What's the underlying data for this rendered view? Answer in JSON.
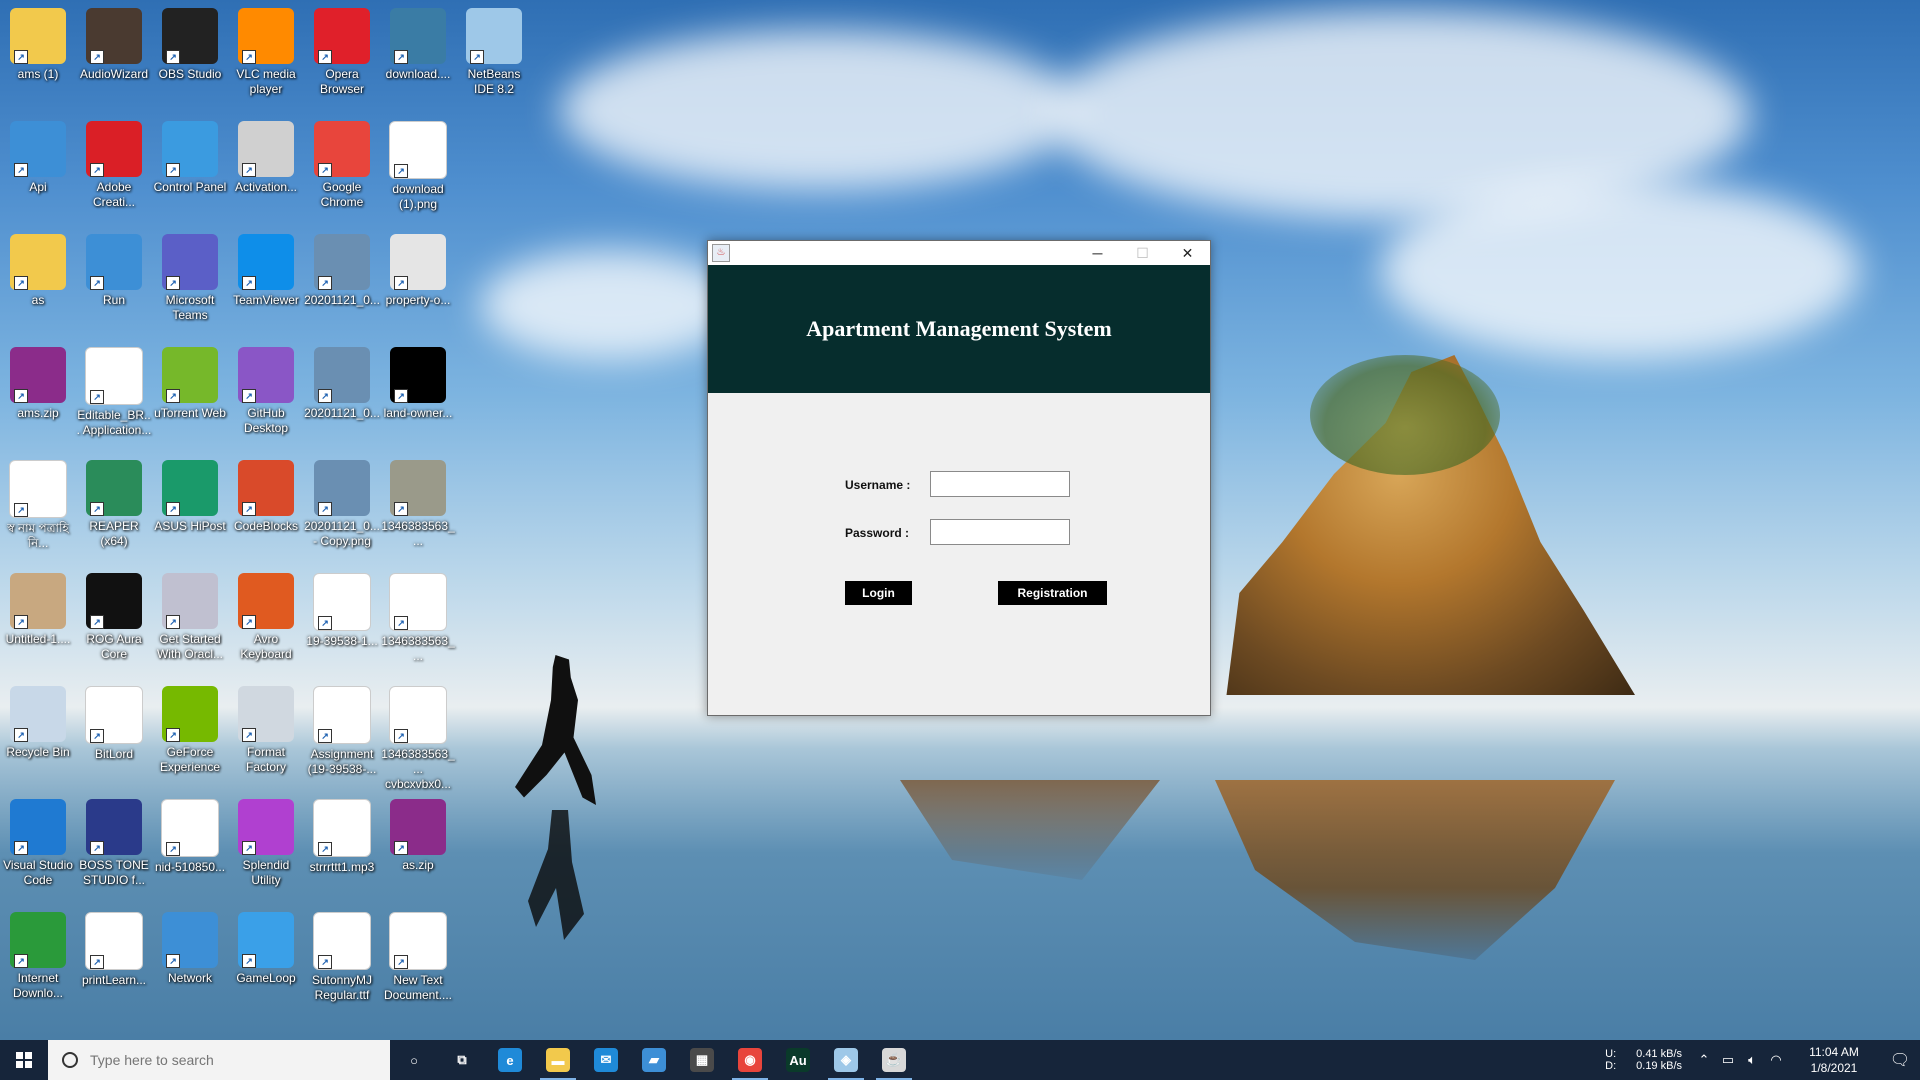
{
  "desktop": {
    "icons": [
      {
        "label": "ams (1)",
        "icon": "folder-icon",
        "color": "#f2c94c"
      },
      {
        "label": "AudioWizard",
        "icon": "audiowizard-icon",
        "color": "#4a3a30"
      },
      {
        "label": "OBS Studio",
        "icon": "obs-icon",
        "color": "#222"
      },
      {
        "label": "VLC media player",
        "icon": "vlc-icon",
        "color": "#ff8a00"
      },
      {
        "label": "Opera Browser",
        "icon": "opera-icon",
        "color": "#e0202a"
      },
      {
        "label": "download....",
        "icon": "user-image-icon",
        "color": "#3a7ca5"
      },
      {
        "label": "NetBeans IDE 8.2",
        "icon": "netbeans-icon",
        "color": "#9ec8e8"
      },
      {
        "label": "Api",
        "icon": "computer-icon",
        "color": "#3d8fd6"
      },
      {
        "label": "Adobe Creati...",
        "icon": "adobe-cc-icon",
        "color": "#da1f26"
      },
      {
        "label": "Control Panel",
        "icon": "control-panel-icon",
        "color": "#3b9be0"
      },
      {
        "label": "Activation...",
        "icon": "gears-icon",
        "color": "#d0d0d0"
      },
      {
        "label": "Google Chrome",
        "icon": "chrome-icon",
        "color": "#e8453c"
      },
      {
        "label": "download (1).png",
        "icon": "house-image-icon",
        "color": "#ffffff"
      },
      {
        "label": "as",
        "icon": "folder-icon",
        "color": "#f2c94c"
      },
      {
        "label": "Run",
        "icon": "run-icon",
        "color": "#3d8fd6"
      },
      {
        "label": "Microsoft Teams",
        "icon": "teams-icon",
        "color": "#5b5fc7"
      },
      {
        "label": "TeamViewer",
        "icon": "teamviewer-icon",
        "color": "#0e8ee9"
      },
      {
        "label": "20201121_0...",
        "icon": "photo-icon",
        "color": "#6a8fb2"
      },
      {
        "label": "property-o...",
        "icon": "image-icon",
        "color": "#e5e5e5"
      },
      {
        "label": "ams.zip",
        "icon": "winrar-icon",
        "color": "#8b2c8a"
      },
      {
        "label": "Editable_BR... Application...",
        "icon": "pdf-icon",
        "color": "#ffffff"
      },
      {
        "label": "uTorrent Web",
        "icon": "utorrent-icon",
        "color": "#76b82a"
      },
      {
        "label": "GitHub Desktop",
        "icon": "github-icon",
        "color": "#8a56c6"
      },
      {
        "label": "20201121_0...",
        "icon": "photo-icon",
        "color": "#6a8fb2"
      },
      {
        "label": "land-owner...",
        "icon": "black-image-icon",
        "color": "#000000"
      },
      {
        "label": "স্ব নাম পত্রাহি নি...",
        "icon": "word-doc-icon",
        "color": "#ffffff"
      },
      {
        "label": "REAPER (x64)",
        "icon": "reaper-icon",
        "color": "#2a8c5a"
      },
      {
        "label": "ASUS HiPost",
        "icon": "asus-hipost-icon",
        "color": "#1a9a6a"
      },
      {
        "label": "CodeBlocks",
        "icon": "codeblocks-icon",
        "color": "#d94a2a"
      },
      {
        "label": "20201121_0... - Copy.png",
        "icon": "photo-icon",
        "color": "#6a8fb2"
      },
      {
        "label": "1346383563_...",
        "icon": "signature-icon",
        "color": "#9a9a8a"
      },
      {
        "label": "Untitled-1....",
        "icon": "photo-person-icon",
        "color": "#c8a880"
      },
      {
        "label": "ROG Aura Core",
        "icon": "rog-aura-icon",
        "color": "#111111"
      },
      {
        "label": "Get Started With Oracl...",
        "icon": "oracle-db-icon",
        "color": "#c0c0d0"
      },
      {
        "label": "Avro Keyboard",
        "icon": "avro-icon",
        "color": "#e05a20"
      },
      {
        "label": "19-39538-1...",
        "icon": "word-doc-icon",
        "color": "#ffffff"
      },
      {
        "label": "1346383563_...",
        "icon": "signature-icon",
        "color": "#ffffff"
      },
      {
        "label": "Recycle Bin",
        "icon": "recycle-bin-icon",
        "color": "#c8d8e8"
      },
      {
        "label": "BitLord",
        "icon": "bitlord-icon",
        "color": "#ffffff"
      },
      {
        "label": "GeForce Experience",
        "icon": "nvidia-icon",
        "color": "#76b900"
      },
      {
        "label": "Format Factory",
        "icon": "format-factory-icon",
        "color": "#d0d8e0"
      },
      {
        "label": "Assignment (19-39538-...",
        "icon": "word-doc-icon",
        "color": "#ffffff"
      },
      {
        "label": "1346383563_... cvbcxvbx0...",
        "icon": "signature-icon",
        "color": "#ffffff"
      },
      {
        "label": "Visual Studio Code",
        "icon": "vscode-icon",
        "color": "#1f7ad2"
      },
      {
        "label": "BOSS TONE STUDIO f...",
        "icon": "boss-tone-icon",
        "color": "#2a3a8a"
      },
      {
        "label": "nid-510850...",
        "icon": "pdf-icon",
        "color": "#ffffff"
      },
      {
        "label": "Splendid Utility",
        "icon": "splendid-icon",
        "color": "#b040d0"
      },
      {
        "label": "strrrttt1.mp3",
        "icon": "mp3-icon",
        "color": "#ffffff"
      },
      {
        "label": "as.zip",
        "icon": "winrar-icon",
        "color": "#8b2c8a"
      },
      {
        "label": "Internet Downlo...",
        "icon": "idm-icon",
        "color": "#2a9a3a"
      },
      {
        "label": "printLearn...",
        "icon": "pdf-icon",
        "color": "#ffffff"
      },
      {
        "label": "Network",
        "icon": "network-icon",
        "color": "#3d8fd6"
      },
      {
        "label": "GameLoop",
        "icon": "gameloop-icon",
        "color": "#3aa0e8"
      },
      {
        "label": "SutonnyMJ Regular.ttf",
        "icon": "font-file-icon",
        "color": "#ffffff"
      },
      {
        "label": "New Text Document....",
        "icon": "text-file-icon",
        "color": "#ffffff"
      }
    ]
  },
  "window": {
    "title": "",
    "icon": "java-icon",
    "minimize_glyph": "─",
    "maximize_glyph": "☐",
    "close_glyph": "✕",
    "header_color": "#062d2d",
    "heading": "Apartment Management System",
    "form": {
      "username_label": "Username :",
      "username_value": "",
      "password_label": "Password :",
      "password_value": "",
      "login_button": "Login",
      "registration_button": "Registration"
    }
  },
  "taskbar": {
    "search_placeholder": "Type here to search",
    "apps": [
      {
        "name": "cortana-icon",
        "glyph": "○",
        "color": "transparent",
        "active": false
      },
      {
        "name": "task-view-icon",
        "glyph": "⧉",
        "color": "transparent",
        "active": false
      },
      {
        "name": "edge-icon",
        "glyph": "e",
        "color": "#1f8ad8",
        "active": false
      },
      {
        "name": "file-explorer-icon",
        "glyph": "▬",
        "color": "#f2c94c",
        "active": true
      },
      {
        "name": "mail-icon",
        "glyph": "✉",
        "color": "#1f8ad8",
        "active": false
      },
      {
        "name": "teams-taskbar-icon",
        "glyph": "▰",
        "color": "#3d8fd6",
        "active": false
      },
      {
        "name": "store-icon",
        "glyph": "▦",
        "color": "#4a4a4a",
        "active": false
      },
      {
        "name": "chrome-taskbar-icon",
        "glyph": "◉",
        "color": "#e8453c",
        "active": true
      },
      {
        "name": "audition-icon",
        "glyph": "Au",
        "color": "#0a3a2a",
        "active": false
      },
      {
        "name": "netbeans-taskbar-icon",
        "glyph": "◈",
        "color": "#9ec8e8",
        "active": true
      },
      {
        "name": "java-taskbar-icon",
        "glyph": "☕",
        "color": "#d8d8d8",
        "active": true
      }
    ],
    "net_upload_label": "U:",
    "net_download_label": "D:",
    "net_upload_speed": "0.41 kB/s",
    "net_download_speed": "0.19 kB/s",
    "time": "11:04 AM",
    "date": "1/8/2021"
  }
}
